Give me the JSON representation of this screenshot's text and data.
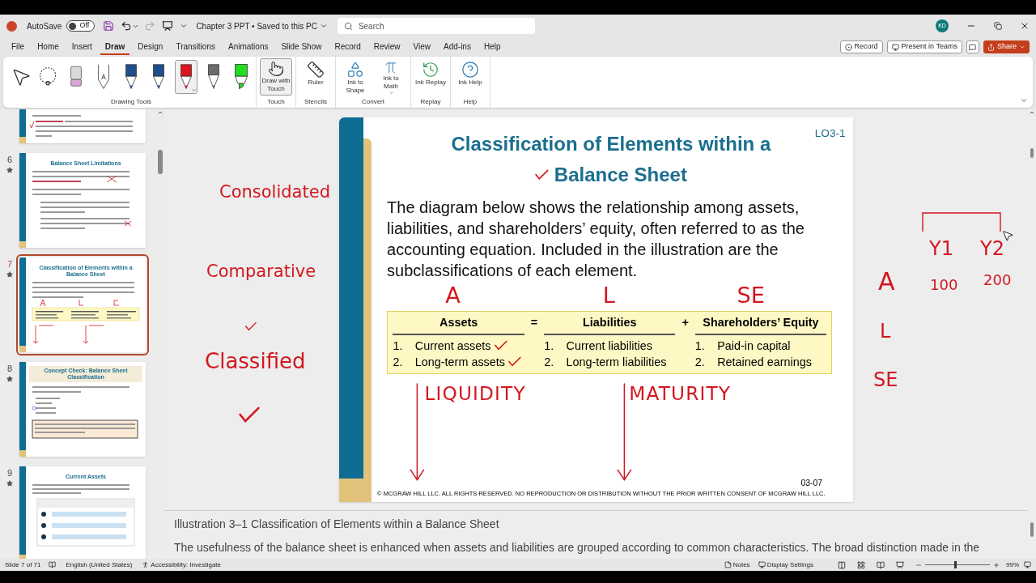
{
  "title_bar": {
    "autosave_label": "AutoSave",
    "autosave": {
      "on": false,
      "label": "Off"
    },
    "document": "Chapter 3 PPT • Saved to this PC",
    "search": {
      "placeholder": "Search"
    },
    "avatar": "KD"
  },
  "menu_tabs": [
    {
      "label": "File",
      "selected": false
    },
    {
      "label": "Home",
      "selected": false
    },
    {
      "label": "Insert",
      "selected": false
    },
    {
      "label": "Draw",
      "selected": true
    },
    {
      "label": "Design",
      "selected": false
    },
    {
      "label": "Transitions",
      "selected": false
    },
    {
      "label": "Animations",
      "selected": false
    },
    {
      "label": "Slide Show",
      "selected": false
    },
    {
      "label": "Record",
      "selected": false
    },
    {
      "label": "Review",
      "selected": false
    },
    {
      "label": "View",
      "selected": false
    },
    {
      "label": "Add-ins",
      "selected": false
    },
    {
      "label": "Help",
      "selected": false
    }
  ],
  "actions": {
    "record": "Record",
    "present": "Present in Teams",
    "share": "Share"
  },
  "ribbon": {
    "tools": [
      {
        "kind": "select",
        "selected": false
      },
      {
        "kind": "lasso",
        "selected": false
      },
      {
        "kind": "eraser",
        "selected": false
      },
      {
        "kind": "action-pen",
        "selected": false
      },
      {
        "kind": "pen",
        "color": "#1f4e8c",
        "selected": false
      },
      {
        "kind": "pen",
        "color": "#1f4e8c",
        "selected": false
      },
      {
        "kind": "pen",
        "color": "#e0141e",
        "selected": true
      },
      {
        "kind": "pencil",
        "color": "#6b6b6b",
        "selected": false
      },
      {
        "kind": "highlighter",
        "color": "#22dd22",
        "selected": false
      }
    ],
    "tools_label": "Drawing Tools",
    "groups": [
      {
        "label": "Touch",
        "buttons": [
          {
            "kind": "touch",
            "label": "Draw with Touch",
            "selected": true,
            "dropdown": false
          }
        ]
      },
      {
        "label": "Stencils",
        "buttons": [
          {
            "kind": "ruler",
            "label": "Ruler",
            "selected": false,
            "dropdown": false
          }
        ]
      },
      {
        "label": "Convert",
        "buttons": [
          {
            "kind": "ink-shape",
            "label": "Ink to Shape",
            "selected": false,
            "dropdown": false
          },
          {
            "kind": "ink-math",
            "label": "Ink to Math",
            "selected": false,
            "dropdown": true
          }
        ]
      },
      {
        "label": "Replay",
        "buttons": [
          {
            "kind": "replay",
            "label": "Ink Replay",
            "selected": false,
            "dropdown": false
          }
        ]
      },
      {
        "label": "Help",
        "buttons": [
          {
            "kind": "help",
            "label": "Ink Help",
            "selected": false,
            "dropdown": false
          }
        ]
      }
    ]
  },
  "thumbnails": [
    {
      "kind": "partial",
      "selected": false
    },
    {
      "kind": "bullets",
      "number": "6",
      "selected": false,
      "title_lines": [
        "Balance Sheet Limitations"
      ]
    },
    {
      "kind": "table",
      "number": "7",
      "selected": true,
      "title_lines": [
        "Classification of Elements within a",
        "Balance Sheet"
      ]
    },
    {
      "kind": "quiz",
      "number": "8",
      "selected": false,
      "title_lines": [
        "Concept Check: Balance Sheet Classification"
      ]
    },
    {
      "kind": "cycle",
      "number": "9",
      "selected": false,
      "title_lines": [
        "Current Assets"
      ]
    }
  ],
  "slide": {
    "lo": "LO3-1",
    "title_lines": [
      "Classification of Elements within a",
      "Balance Sheet"
    ],
    "title_check": true,
    "body": "The diagram below shows the relationship among assets, liabilities, and shareholders’ equity, often referred to as the accounting equation. Included in the illustration are the subclassifications of each element.",
    "ink_letters": [
      "A",
      "L",
      "SE"
    ],
    "table": {
      "operators": [
        "=",
        "+"
      ],
      "columns": [
        {
          "heading": "Assets",
          "items": [
            {
              "num": "1.",
              "text": "Current assets",
              "ink_check": true
            },
            {
              "num": "2.",
              "text": "Long-term assets",
              "ink_check": true
            }
          ]
        },
        {
          "heading": "Liabilities",
          "items": [
            {
              "num": "1.",
              "text": "Current liabilities",
              "ink_check": false
            },
            {
              "num": "2.",
              "text": "Long-term liabilities",
              "ink_check": false
            }
          ]
        },
        {
          "heading": "Shareholders’ Equity",
          "items": [
            {
              "num": "1.",
              "text": "Paid-in capital",
              "ink_check": false
            },
            {
              "num": "2.",
              "text": "Retained earnings",
              "ink_check": false
            }
          ]
        }
      ]
    },
    "ink_words": [
      "LIQUIDITY",
      "MATURITY"
    ],
    "page": "03-07",
    "footer": "© MCGRAW HILL LLC. ALL RIGHTS RESERVED. NO REPRODUCTION OR DISTRIBUTION WITHOUT THE PRIOR WRITTEN CONSENT OF MCGRAW HILL LLC."
  },
  "canvas_ink": [
    "Consolidated",
    "Comparative",
    "Classified",
    "Y1",
    "Y2",
    "A",
    "100",
    "200",
    "L",
    "SE"
  ],
  "notes": [
    "Illustration 3–1 Classification of Elements within a Balance Sheet",
    "The usefulness of the balance sheet is enhanced when assets and liabilities are grouped according to common characteristics. The broad distinction made in the"
  ],
  "status_bar": {
    "slide": "Slide 7 of 71",
    "language": "English (United States)",
    "accessibility": "Accessibility: Investigate",
    "notes": "Notes",
    "display": "Display Settings",
    "zoom": "99%",
    "zoom_slider": {
      "level": 0.45
    }
  }
}
